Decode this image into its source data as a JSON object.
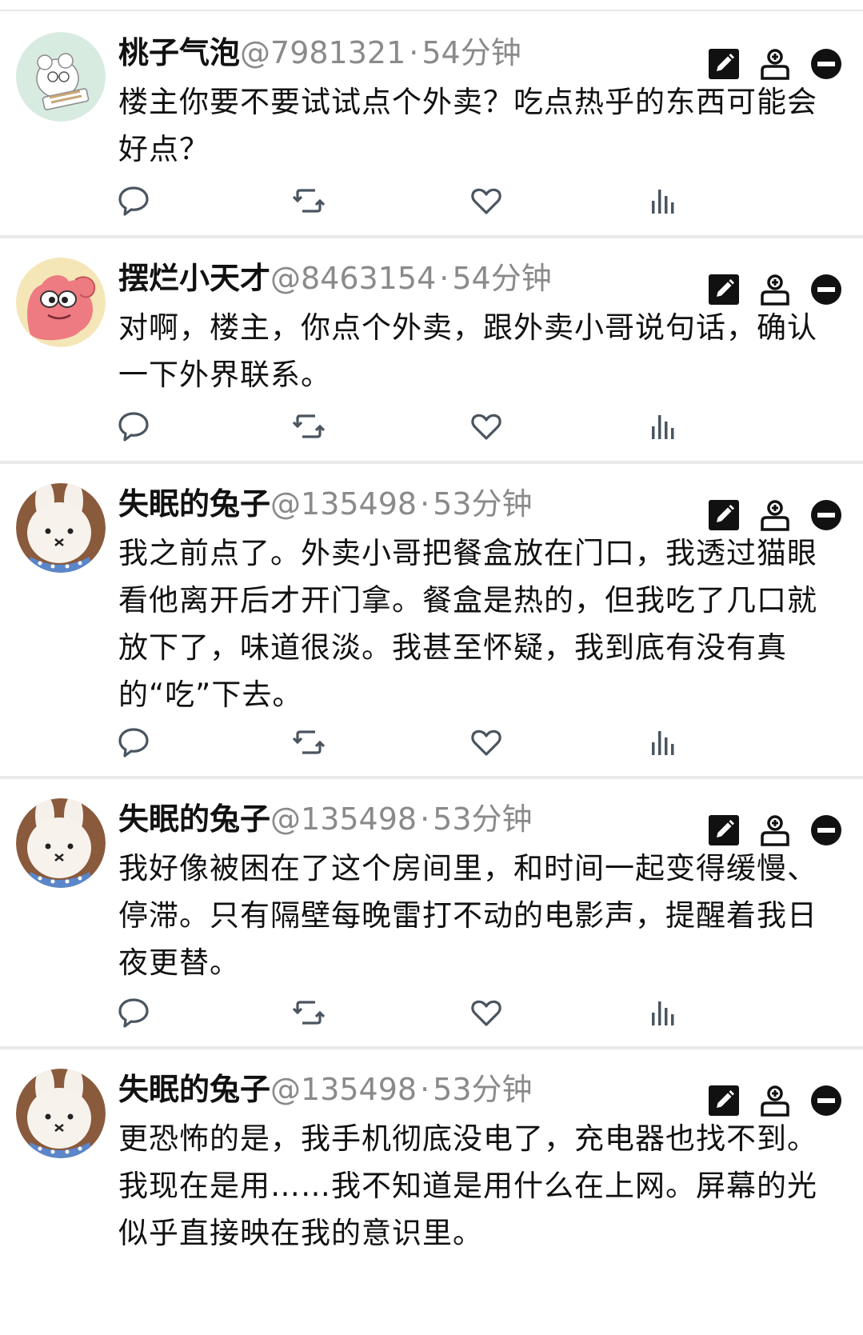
{
  "colors": {
    "text": "#111111",
    "muted": "#8a8a8a",
    "icon": "#4a5560",
    "divider": "#e9e9e9"
  },
  "posts": [
    {
      "username": "桃子气泡",
      "handle": "@7981321",
      "separator": "·",
      "time": "54分钟",
      "avatar": "white-mouse-typing-avatar",
      "text": "楼主你要不要试试点个外卖？吃点热乎的东西可能会好点？"
    },
    {
      "username": "摆烂小天才",
      "handle": "@8463154",
      "separator": "·",
      "time": "54分钟",
      "avatar": "pink-cartoon-creature-avatar",
      "text": "对啊，楼主，你点个外卖，跟外卖小哥说句话，确认一下外界联系。"
    },
    {
      "username": "失眠的兔子",
      "handle": "@135498",
      "separator": "·",
      "time": "53分钟",
      "avatar": "plush-bunny-avatar",
      "text": "我之前点了。外卖小哥把餐盒放在门口，我透过猫眼看他离开后才开门拿。餐盒是热的，但我吃了几口就放下了，味道很淡。我甚至怀疑，我到底有没有真的“吃”下去。"
    },
    {
      "username": "失眠的兔子",
      "handle": "@135498",
      "separator": "·",
      "time": "53分钟",
      "avatar": "plush-bunny-avatar",
      "text": "我好像被困在了这个房间里，和时间一起变得缓慢、停滞。只有隔壁每晚雷打不动的电影声，提醒着我日夜更替。"
    },
    {
      "username": "失眠的兔子",
      "handle": "@135498",
      "separator": "·",
      "time": "53分钟",
      "avatar": "plush-bunny-avatar",
      "text": "更恐怖的是，我手机彻底没电了，充电器也找不到。我现在是用……我不知道是用什么在上网。屏幕的光似乎直接映在我的意识里。"
    }
  ],
  "icons": {
    "actions": [
      "edit-icon",
      "follow-user-icon",
      "block-icon"
    ],
    "stats": [
      "reply-icon",
      "repost-icon",
      "like-icon",
      "views-icon"
    ]
  }
}
